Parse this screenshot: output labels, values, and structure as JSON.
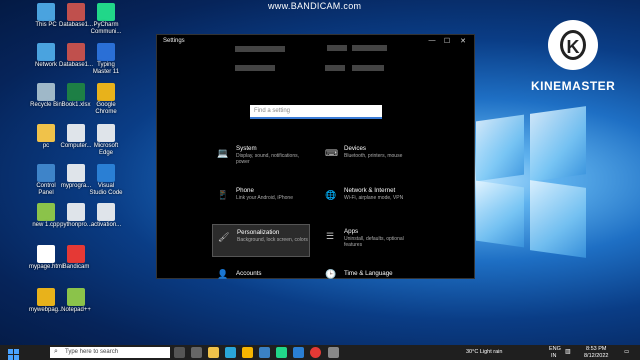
{
  "watermark": {
    "bandicam": "www.BANDICAM.com",
    "kinemaster": "KINEMASTER",
    "kinemaster_glyph": "K"
  },
  "desktop_icons": [
    {
      "label": "This PC",
      "color": "#4aa3df"
    },
    {
      "label": "Database1...",
      "color": "#c0504d"
    },
    {
      "label": "PyCharm Communi...",
      "color": "#21d789"
    },
    {
      "label": "Network",
      "color": "#4aa3df"
    },
    {
      "label": "Database1...",
      "color": "#c0504d"
    },
    {
      "label": "Typing Master 11",
      "color": "#2a6fd6"
    },
    {
      "label": "Recycle Bin",
      "color": "#9fb8c8"
    },
    {
      "label": "Book1.xlsx",
      "color": "#1d7f45"
    },
    {
      "label": "Google Chrome",
      "color": "#e8b21b"
    },
    {
      "label": "pc",
      "color": "#f0c24a"
    },
    {
      "label": "Computer...",
      "color": "#dfe4ea"
    },
    {
      "label": "Microsoft Edge",
      "color": "#dfe4ea"
    },
    {
      "label": "Control Panel",
      "color": "#3e84c9"
    },
    {
      "label": "myprogra...",
      "color": "#dfe4ea"
    },
    {
      "label": "Visual Studio Code",
      "color": "#2a7fd4"
    },
    {
      "label": "new 1.cpp",
      "color": "#8bc34a"
    },
    {
      "label": "pythonpro...",
      "color": "#dfe4ea"
    },
    {
      "label": "activation...",
      "color": "#dfe4ea"
    },
    {
      "label": "mypage.html",
      "color": "#ffffff"
    },
    {
      "label": "Bandicam",
      "color": "#e53935"
    },
    {
      "label": "mywebpag...",
      "color": "#e8b21b"
    },
    {
      "label": "Notepad++",
      "color": "#8bc34a"
    }
  ],
  "settings": {
    "title": "Settings",
    "controls": {
      "minimize": "—",
      "maximize": "☐",
      "close": "✕"
    },
    "search_placeholder": "Find a setting",
    "categories": [
      {
        "name": "System",
        "desc": "Display, sound, notifications, power",
        "icon": "💻"
      },
      {
        "name": "Devices",
        "desc": "Bluetooth, printers, mouse",
        "icon": "⌨"
      },
      {
        "name": "Phone",
        "desc": "Link your Android, iPhone",
        "icon": "📱"
      },
      {
        "name": "Network & Internet",
        "desc": "Wi-Fi, airplane mode, VPN",
        "icon": "🌐"
      },
      {
        "name": "Personalization",
        "desc": "Background, lock screen, colors",
        "icon": "🖌"
      },
      {
        "name": "Apps",
        "desc": "Uninstall, defaults, optional features",
        "icon": "☰"
      },
      {
        "name": "Accounts",
        "desc": "",
        "icon": "👤"
      },
      {
        "name": "Time & Language",
        "desc": "",
        "icon": "🕒"
      }
    ]
  },
  "taskbar": {
    "search_text": "Type here to search",
    "weather": "30°C  Light rain",
    "lang": "ENG",
    "region": "IN",
    "time": "8:53 PM",
    "date": "8/12/2022"
  }
}
